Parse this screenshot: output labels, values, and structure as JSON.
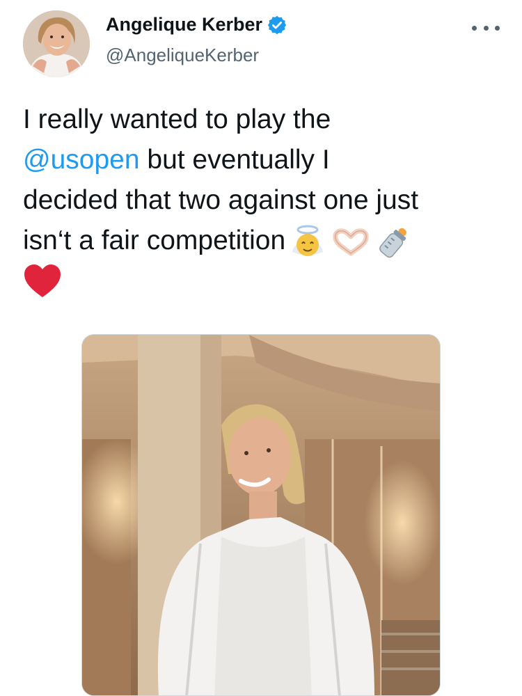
{
  "author": {
    "name": "Angelique Kerber",
    "handle": "@AngeliqueKerber",
    "verified": true,
    "verified_color": "#1d9bf0"
  },
  "tweet": {
    "line1": "I really wanted to play the",
    "mention": "@usopen",
    "line2_rest": " but eventually I",
    "line3": "decided that two against one just",
    "line4": "isn‘t a fair competition",
    "emojis": [
      "angel-emoji",
      "heart-hands-emoji",
      "baby-bottle-emoji",
      "red-heart-emoji"
    ]
  },
  "colors": {
    "text": "#0f1419",
    "secondary": "#536471",
    "link": "#1d9bf0",
    "heart": "#e0243c"
  },
  "icons": {
    "more": "more-options-icon"
  }
}
